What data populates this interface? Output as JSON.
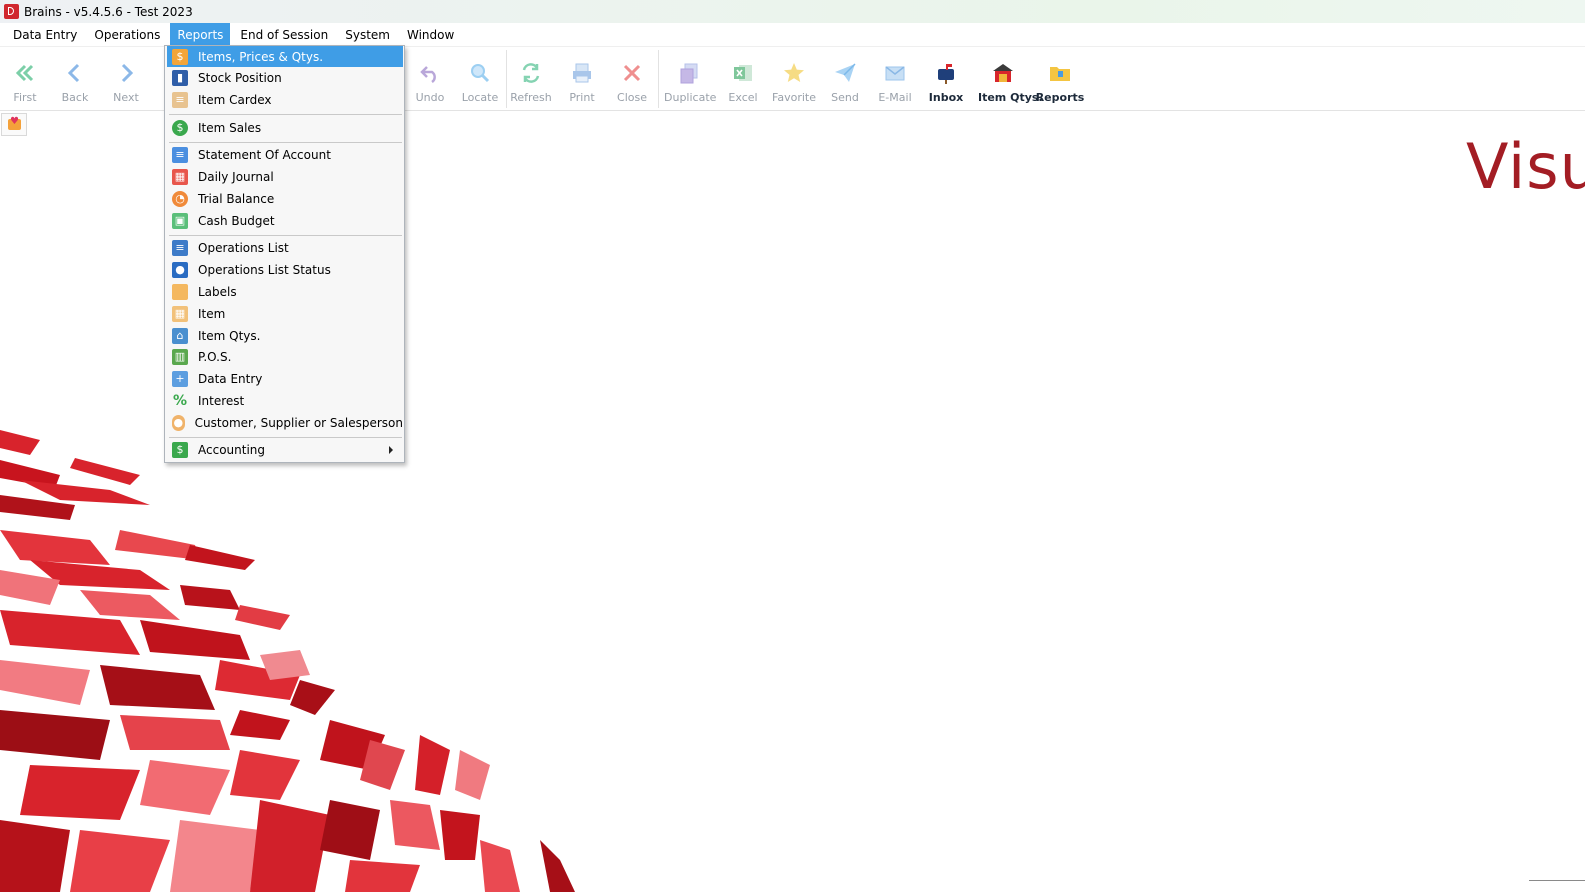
{
  "window": {
    "title": "Brains - v5.4.5.6 - Test 2023"
  },
  "menubar": {
    "items": [
      "Data Entry",
      "Operations",
      "Reports",
      "End of Session",
      "System",
      "Window"
    ],
    "active": "Reports"
  },
  "toolbar": {
    "first": "First",
    "back": "Back",
    "next": "Next",
    "undo": "Undo",
    "locate": "Locate",
    "refresh": "Refresh",
    "print": "Print",
    "close": "Close",
    "duplicate": "Duplicate",
    "excel": "Excel",
    "favorite": "Favorite",
    "send": "Send",
    "email": "E-Mail",
    "inbox": "Inbox",
    "item_qtys": "Item Qtys.",
    "reports": "Reports"
  },
  "reports_menu": {
    "items": [
      "Items, Prices & Qtys.",
      "Stock Position",
      "Item Cardex",
      "Item Sales",
      "Statement Of Account",
      "Daily Journal",
      "Trial Balance",
      "Cash Budget",
      "Operations List",
      "Operations List Status",
      "Labels",
      "Item",
      "Item Qtys.",
      "P.O.S.",
      "Data Entry",
      "Interest",
      "Customer, Supplier or Salesperson",
      "Accounting"
    ],
    "highlighted": "Items, Prices & Qtys."
  },
  "background": {
    "brand_text": "Visu"
  },
  "colors": {
    "accent": "#3f9de6",
    "brand": "#a31d24"
  }
}
